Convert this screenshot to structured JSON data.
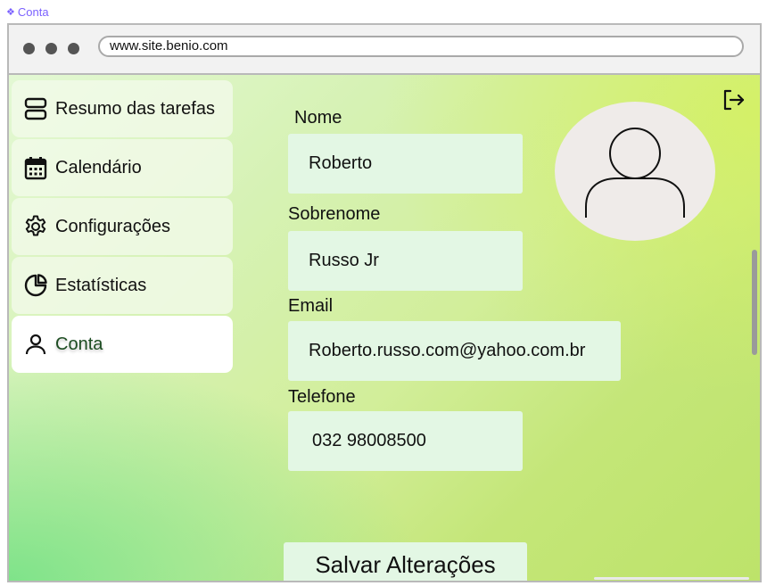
{
  "frame_label": "Conta",
  "browser": {
    "url": "www.site.benio.com"
  },
  "sidebar": {
    "items": [
      {
        "label": "Resumo das tarefas",
        "icon": "list-summary-icon"
      },
      {
        "label": "Calendário",
        "icon": "calendar-icon"
      },
      {
        "label": "Configurações",
        "icon": "gear-icon"
      },
      {
        "label": "Estatísticas",
        "icon": "pie-chart-icon"
      },
      {
        "label": "Conta",
        "icon": "user-icon",
        "active": true
      }
    ]
  },
  "form": {
    "nome": {
      "label": "Nome",
      "value": "Roberto"
    },
    "sobrenome": {
      "label": "Sobrenome",
      "value": "Russo Jr"
    },
    "email": {
      "label": "Email",
      "value": "Roberto.russo.com@yahoo.com.br"
    },
    "telefone": {
      "label": "Telefone",
      "value": "032 98008500"
    },
    "save_label": "Salvar Alterações"
  },
  "colors": {
    "field_bg": "#e3f7e4",
    "active_item_text": "#1d4d22",
    "gradient_light": "#e3f8d4",
    "gradient_dark": "#bde36a",
    "gradient_accent": "#7fe38a"
  }
}
